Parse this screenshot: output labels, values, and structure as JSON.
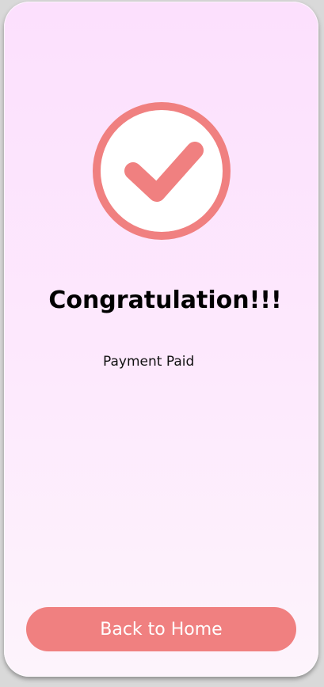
{
  "success": {
    "icon": "check-circle-icon",
    "title": "Congratulation!!!",
    "message": "Payment Paid"
  },
  "actions": {
    "home_label": "Back to Home"
  },
  "colors": {
    "accent": "#f08080",
    "background_top": "#fce0fd",
    "background_bottom": "#fdf4fc"
  }
}
